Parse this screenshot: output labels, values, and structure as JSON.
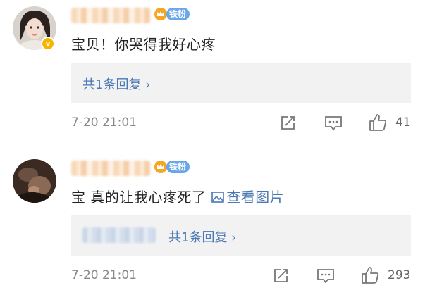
{
  "comments": [
    {
      "fan_badge": "铁粉",
      "verified_badge": "v",
      "text": "宝贝！你哭得我好心疼",
      "reply_link": "共1条回复 ›",
      "time": "7-20 21:01",
      "likes": "41"
    },
    {
      "fan_badge": "铁粉",
      "text": "宝  真的让我心疼死了",
      "picture_link": "查看图片",
      "reply_link": "共1条回复 ›",
      "time": "7-20 21:01",
      "likes": "293"
    }
  ],
  "colors": {
    "link": "#4a77b5",
    "fan_badge_bg": "#6aa7e8",
    "verified_bg": "#f7b500",
    "reply_box_bg": "#f2f2f2",
    "muted_text": "#888888"
  },
  "icons": [
    "crown-icon",
    "share-icon",
    "comment-icon",
    "like-icon",
    "image-icon",
    "verified-icon"
  ]
}
